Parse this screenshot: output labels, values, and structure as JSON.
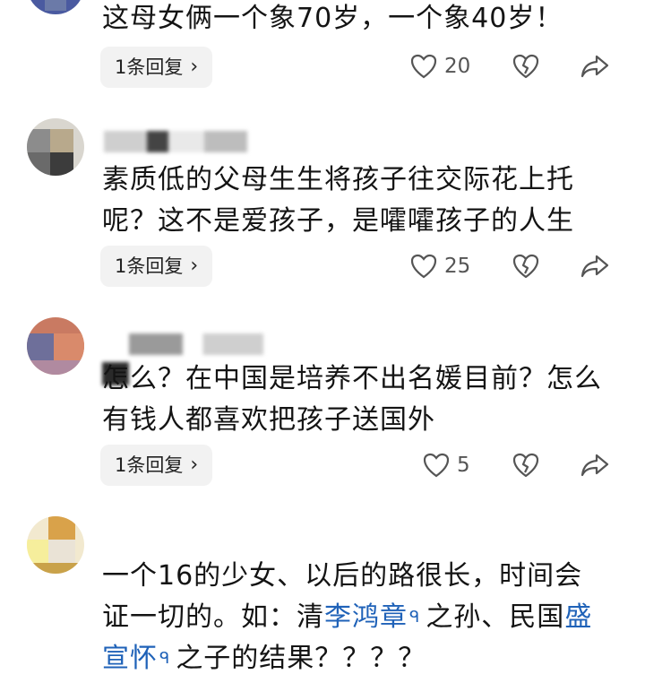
{
  "comments": [
    {
      "text": "这母女俩一个象70岁，一个象40岁！",
      "reply_label": "1条回复",
      "likes": "20"
    },
    {
      "text": "素质低的父母生生将孩子往交际花上托呢？这不是爱孩子，是嚯嚯孩子的人生",
      "reply_label": "1条回复",
      "likes": "25"
    },
    {
      "text": "怎么？在中国是培养不出名媛目前？怎么有钱人都喜欢把孩子送国外",
      "reply_label": "1条回复",
      "likes": "5"
    },
    {
      "text_parts": [
        "一个16的少女、以后的路很长，时间会证一切的。如：清",
        "李鸿章",
        "之孙、民国",
        "盛宣怀",
        "之子的结果？？？？"
      ],
      "search_icon_glyph": "ᑫ"
    }
  ],
  "icons": {
    "like": "heart-outline-icon",
    "dislike": "broken-heart-icon",
    "share": "share-arrow-icon",
    "chevron": "chevron-right-icon"
  },
  "colors": {
    "link": "#1f62b8",
    "reply_bg": "#f2f2f2"
  },
  "glyphs": {
    "chevron": "›"
  }
}
